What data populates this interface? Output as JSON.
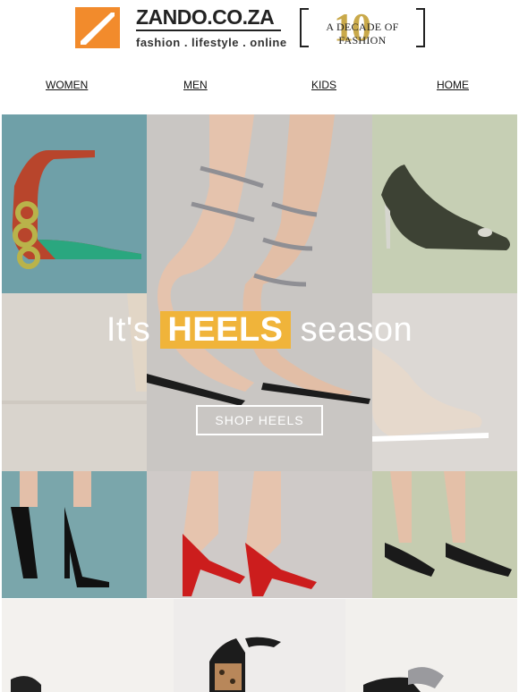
{
  "header": {
    "brand": "ZANDO.CO.ZA",
    "tagline": "fashion . lifestyle . online",
    "decade_number": "10",
    "decade_text": "A DECADE OF FASHION"
  },
  "nav": {
    "items": [
      "WOMEN",
      "MEN",
      "KIDS",
      "HOME"
    ]
  },
  "hero": {
    "prefix": "It's",
    "highlight": "HEELS",
    "suffix": "season",
    "button": "SHOP HEELS"
  },
  "colors": {
    "accent": "#f28b2c",
    "highlight": "#f0b43a"
  },
  "icons": [
    "zando-logo-icon"
  ]
}
